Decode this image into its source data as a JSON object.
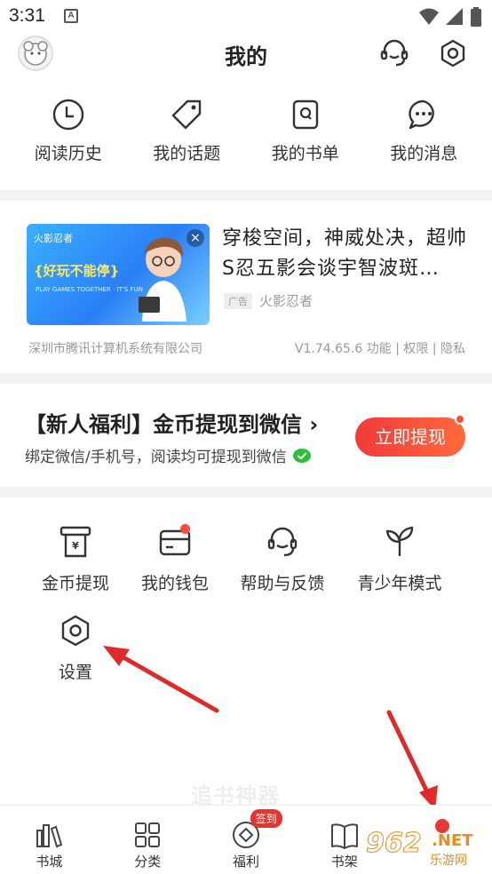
{
  "status_bar": {
    "time": "3:31",
    "notif_letter": "A"
  },
  "header": {
    "title": "我的"
  },
  "quick_actions": [
    {
      "label": "阅读历史",
      "icon": "clock-icon"
    },
    {
      "label": "我的话题",
      "icon": "tag-icon"
    },
    {
      "label": "我的书单",
      "icon": "booklist-icon"
    },
    {
      "label": "我的消息",
      "icon": "message-icon"
    }
  ],
  "ad": {
    "brand_small": "火影忍者",
    "slogan": "{好玩不能停}",
    "slogan_sub": "PLAY GAMES TOGETHER · IT'S FUN",
    "title": "穿梭空间，神威处决，超帅S忍五影会谈宇智波斑…",
    "tag": "广告",
    "brand": "火影忍者",
    "company": "深圳市腾讯计算机系统有限公司",
    "version": "V1.74.65.6  功能 | 权限 | 隐私"
  },
  "promo": {
    "title": "【新人福利】金币提现到微信 ›",
    "subtitle": "绑定微信/手机号，阅读均可提现到微信",
    "button": "立即提现"
  },
  "tools": [
    {
      "label": "金币提现",
      "icon": "coin-withdraw-icon"
    },
    {
      "label": "我的钱包",
      "icon": "wallet-icon"
    },
    {
      "label": "帮助与反馈",
      "icon": "headset-icon"
    },
    {
      "label": "青少年模式",
      "icon": "sprout-icon"
    },
    {
      "label": "设置",
      "icon": "settings-hex-icon"
    }
  ],
  "watermark": "追书神器",
  "tabs": [
    {
      "label": "书城",
      "icon": "bookstore-icon"
    },
    {
      "label": "分类",
      "icon": "grid-icon"
    },
    {
      "label": "福利",
      "icon": "welfare-icon",
      "badge": "签到"
    },
    {
      "label": "书架",
      "icon": "book-icon"
    },
    {
      "label": "",
      "icon": "profile-icon"
    }
  ],
  "site_logo": {
    "big": "962",
    "net": ".NET",
    "cn": "乐游网"
  },
  "colors": {
    "accent_red": "#e8342f",
    "button_gradient_start": "#f23a3a",
    "button_gradient_end": "#ff6a3c"
  }
}
